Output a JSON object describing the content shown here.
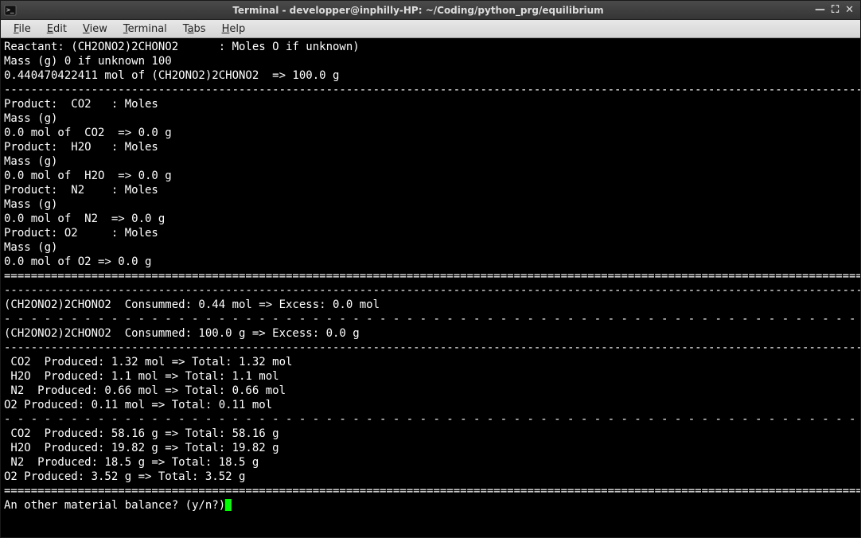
{
  "window": {
    "title": "Terminal - developper@inphilly-HP: ~/Coding/python_prg/equilibrium"
  },
  "menus": {
    "file": "File",
    "edit": "Edit",
    "view": "View",
    "terminal": "Terminal",
    "tabs": "Tabs",
    "help": "Help"
  },
  "terminal": {
    "lines": [
      "Reactant: (CH2ONO2)2CHONO2      : Moles O if unknown)",
      "Mass (g) 0 if unknown 100",
      "0.440470422411 mol of (CH2ONO2)2CHONO2  => 100.0 g",
      "----------------------------------------------------------------------------------------------------------------------------------",
      "Product:  CO2   : Moles",
      "Mass (g)",
      "0.0 mol of  CO2  => 0.0 g",
      "Product:  H2O   : Moles",
      "Mass (g)",
      "0.0 mol of  H2O  => 0.0 g",
      "Product:  N2    : Moles",
      "Mass (g)",
      "0.0 mol of  N2  => 0.0 g",
      "Product: O2     : Moles",
      "Mass (g)",
      "0.0 mol of O2 => 0.0 g",
      "==================================================================================================================================",
      "----------------------------------------------------------------------------------------------------------------------------------",
      "(CH2ONO2)2CHONO2  Consummed: 0.44 mol => Excess: 0.0 mol",
      "- - - - - - - - - - - - - - - - - - - - - - - - - - - - - - - - - - - - - - - - - - - - - - - - - - - - - - - - - - - - - - - - - ",
      "(CH2ONO2)2CHONO2  Consummed: 100.0 g => Excess: 0.0 g",
      "----------------------------------------------------------------------------------------------------------------------------------",
      " CO2  Produced: 1.32 mol => Total: 1.32 mol",
      " H2O  Produced: 1.1 mol => Total: 1.1 mol",
      " N2  Produced: 0.66 mol => Total: 0.66 mol",
      "O2 Produced: 0.11 mol => Total: 0.11 mol",
      "- - - - - - - - - - - - - - - - - - - - - - - - - - - - - - - - - - - - - - - - - - - - - - - - - - - - - - - - - - - - - - - - - ",
      " CO2  Produced: 58.16 g => Total: 58.16 g",
      " H2O  Produced: 19.82 g => Total: 19.82 g",
      " N2  Produced: 18.5 g => Total: 18.5 g",
      "O2 Produced: 3.52 g => Total: 3.52 g",
      "=================================================================================================================================="
    ],
    "prompt": "An other material balance? (y/n?)"
  }
}
